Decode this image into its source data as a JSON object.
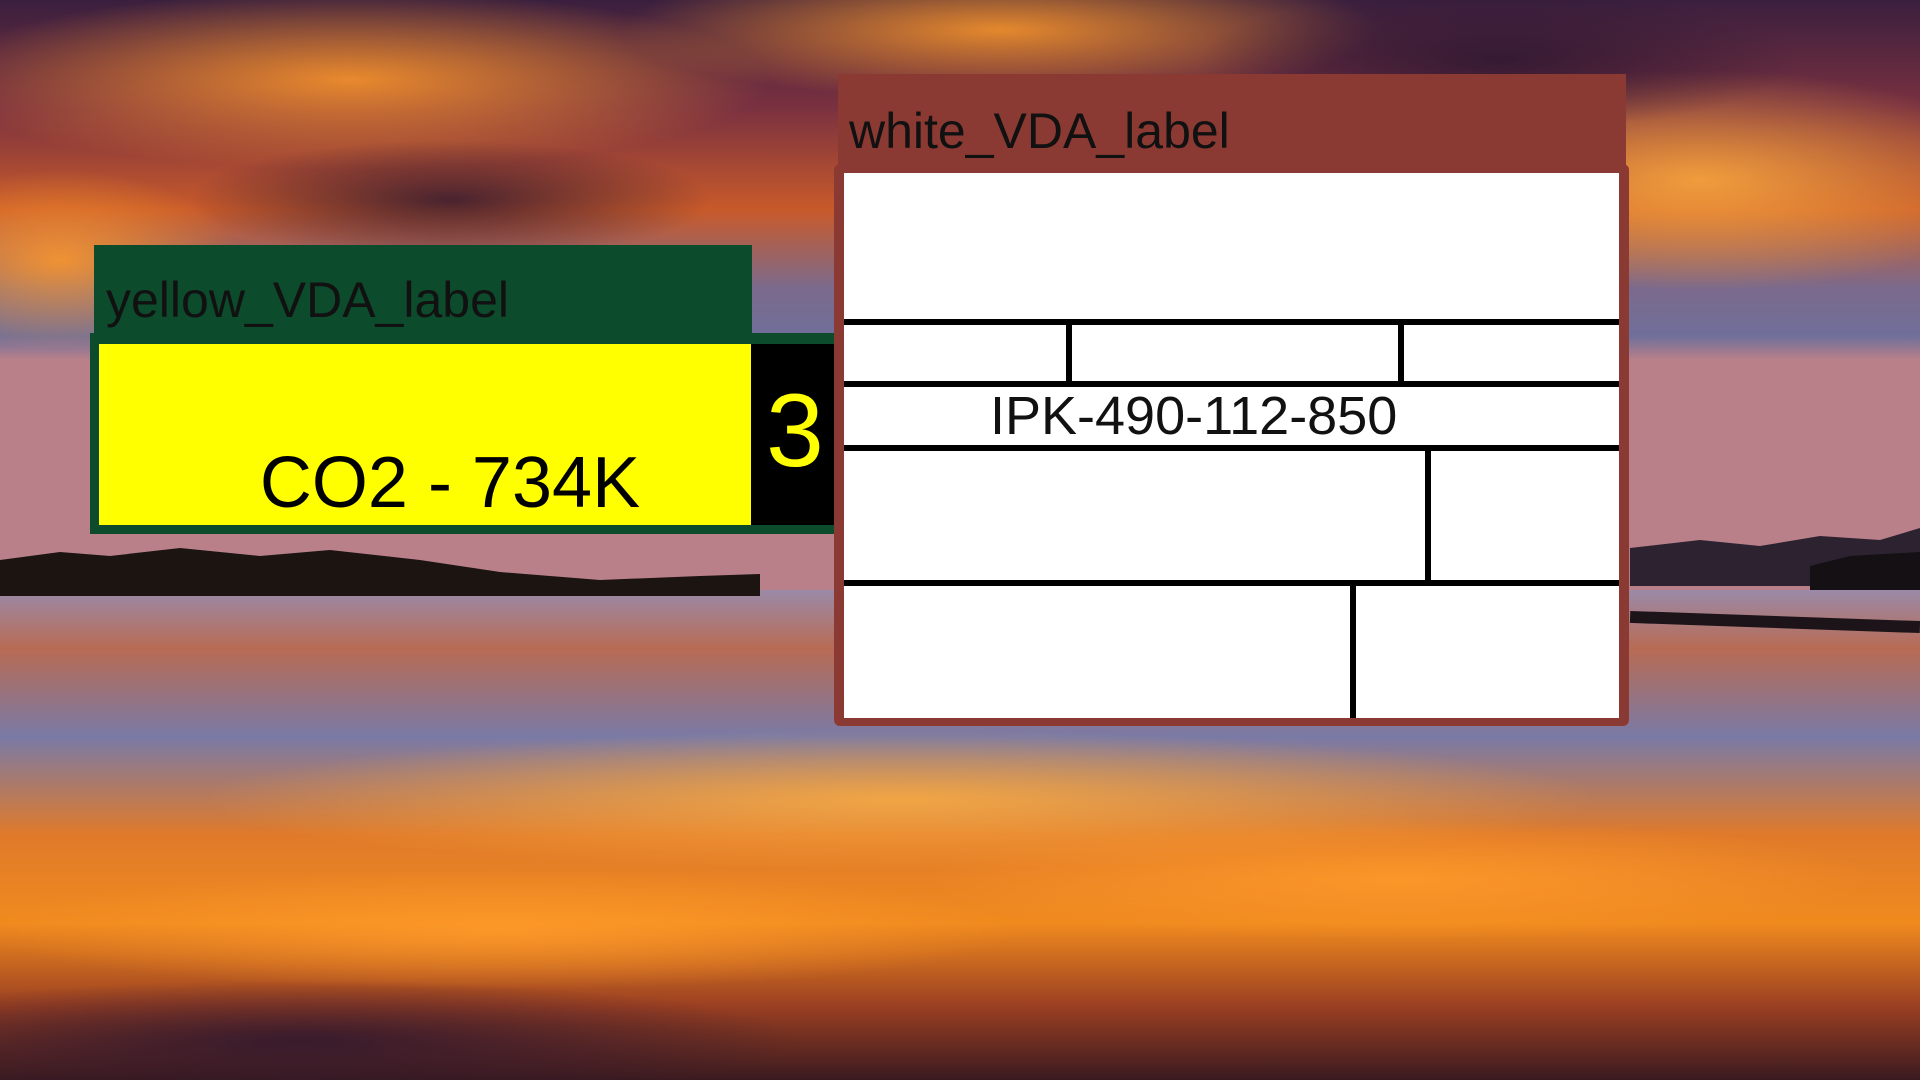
{
  "colors": {
    "yellow_label_header": "#0d4b2d",
    "yellow_label_face": "#ffff00",
    "yellow_label_digit": "#ffff00",
    "white_label_header": "#8b3a33",
    "white_label_face": "#ffffff"
  },
  "yellow_label": {
    "title": "yellow_VDA_label",
    "text": "CO2 - 734K",
    "digit": "3"
  },
  "white_label": {
    "title": "white_VDA_label",
    "code": "IPK-490-112-850"
  }
}
